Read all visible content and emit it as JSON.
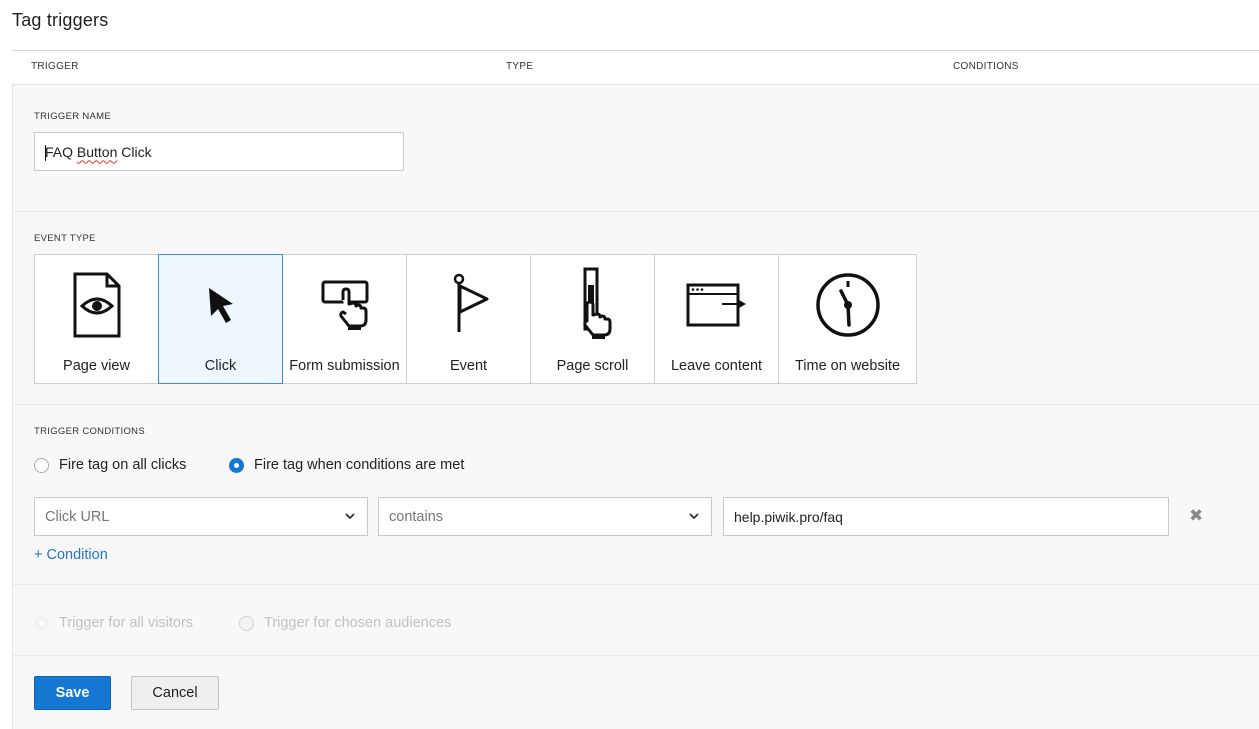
{
  "page": {
    "title": "Tag triggers"
  },
  "table_headers": [
    "TRIGGER",
    "TYPE",
    "CONDITIONS"
  ],
  "trigger_name": {
    "label": "TRIGGER NAME",
    "value": "FAQ Button Click"
  },
  "event_type": {
    "label": "EVENT TYPE",
    "selected": "Click",
    "options": [
      {
        "label": "Page view",
        "icon": "page-view-icon"
      },
      {
        "label": "Click",
        "icon": "cursor-icon"
      },
      {
        "label": "Form submission",
        "icon": "form-submission-icon"
      },
      {
        "label": "Event",
        "icon": "flag-icon"
      },
      {
        "label": "Page scroll",
        "icon": "page-scroll-icon"
      },
      {
        "label": "Leave content",
        "icon": "leave-content-icon"
      },
      {
        "label": "Time on website",
        "icon": "clock-icon"
      }
    ]
  },
  "trigger_conditions": {
    "label": "TRIGGER CONDITIONS",
    "mode_all": "Fire tag on all clicks",
    "mode_conditions": "Fire tag when conditions are met",
    "selected_mode": "conditions",
    "condition": {
      "variable": "Click URL",
      "operator": "contains",
      "value": "help.piwik.pro/faq"
    },
    "add_condition": "+ Condition"
  },
  "audience": {
    "all_visitors": "Trigger for all visitors",
    "chosen_audiences": "Trigger for chosen audiences",
    "disabled": true
  },
  "actions": {
    "save": "Save",
    "cancel": "Cancel"
  },
  "colors": {
    "primary": "#1677d2",
    "link": "#1f76c9",
    "selected_tile_bg": "#eef7fe",
    "selected_tile_border": "#3a8fd9"
  }
}
